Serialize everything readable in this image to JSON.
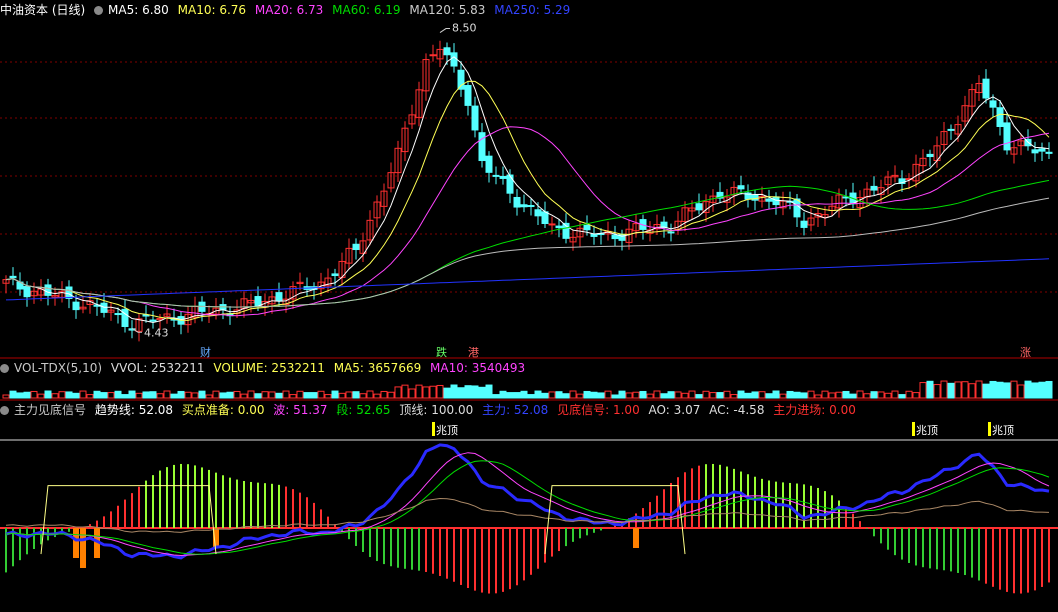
{
  "main_header": {
    "title": "中油资本 (日线)",
    "ma5": "MA5: 6.80",
    "ma10": "MA10: 6.76",
    "ma20": "MA20: 6.73",
    "ma60": "MA60: 6.19",
    "ma120": "MA120: 5.83",
    "ma250": "MA250: 5.29"
  },
  "vol_header": {
    "name": "VOL-TDX(5,10)",
    "vvol": "VVOL: 2532211",
    "volume": "VOLUME: 2532211",
    "ma5": "MA5: 3657669",
    "ma10": "MA10: 3540493"
  },
  "ind_header": {
    "name": "主力见底信号",
    "trend": "趋势线: 52.08",
    "buy_prep": "买点准备: 0.00",
    "wave": "波: 51.37",
    "seg": "段: 52.65",
    "top": "顶线: 100.00",
    "main": "主力: 52.08",
    "bottom_sig": "见底信号: 1.00",
    "ao": "AO: 3.07",
    "ac": "AC: -4.58",
    "enter": "主力进场: 0.00"
  },
  "colors": {
    "ma5": "#ffffff",
    "ma10": "#ffff55",
    "ma20": "#ff44ff",
    "ma60": "#00dd00",
    "ma120": "#bbbbbb",
    "ma250": "#2233ff",
    "up": "#ff3030",
    "down": "#54ffff",
    "grid": "#800000",
    "zhuli": "#2a2aff",
    "buy": "#ff8000"
  },
  "chart_data": {
    "type": "candlestick",
    "y_range": [
      4.2,
      8.7
    ],
    "high_label": "8.50",
    "low_label": "4.43",
    "markers": [
      {
        "text": "财",
        "color": "#66aaff"
      },
      {
        "text": "跌",
        "color": "#66ff66"
      },
      {
        "text": "港",
        "color": "#ff6666"
      },
      {
        "text": "涨",
        "color": "#ff6666"
      }
    ],
    "top_signal_label": "兆顶",
    "indicator_y_range": [
      0,
      100
    ]
  }
}
